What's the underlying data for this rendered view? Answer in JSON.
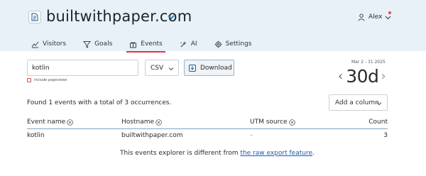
{
  "header": {
    "site_name": "builtwithpaper.com",
    "user_name": "Alex",
    "colors": {
      "background": "#e8f1f7",
      "accent": "#e4333f",
      "notification_dot": "#e5484d"
    }
  },
  "tabs": [
    {
      "label": "Visitors",
      "icon": "chart-icon",
      "active": false
    },
    {
      "label": "Goals",
      "icon": "funnel-icon",
      "active": false
    },
    {
      "label": "Events",
      "icon": "gift-icon",
      "active": true
    },
    {
      "label": "AI",
      "icon": "sparkle-tools-icon",
      "active": false
    },
    {
      "label": "Settings",
      "icon": "gear-icon",
      "active": false
    }
  ],
  "controls": {
    "search_value": "kotlin",
    "include_pageviews_label": "Include pageviews",
    "format_selected": "CSV",
    "download_label": "Download",
    "date_range": "Mar 2 - 31 2025",
    "period_value": "30d",
    "add_column_label": "Add a column"
  },
  "summary": "Found 1 events with a total of 3 occurrences.",
  "table": {
    "columns": [
      "Event name",
      "Hostname",
      "UTM source",
      "Count"
    ],
    "rows": [
      {
        "event": "kotlin",
        "hostname": "builtwithpaper.com",
        "utm": "–",
        "count": "3"
      }
    ]
  },
  "footer": {
    "text": "This events explorer is different from ",
    "link": "the raw export feature",
    "suffix": "."
  }
}
